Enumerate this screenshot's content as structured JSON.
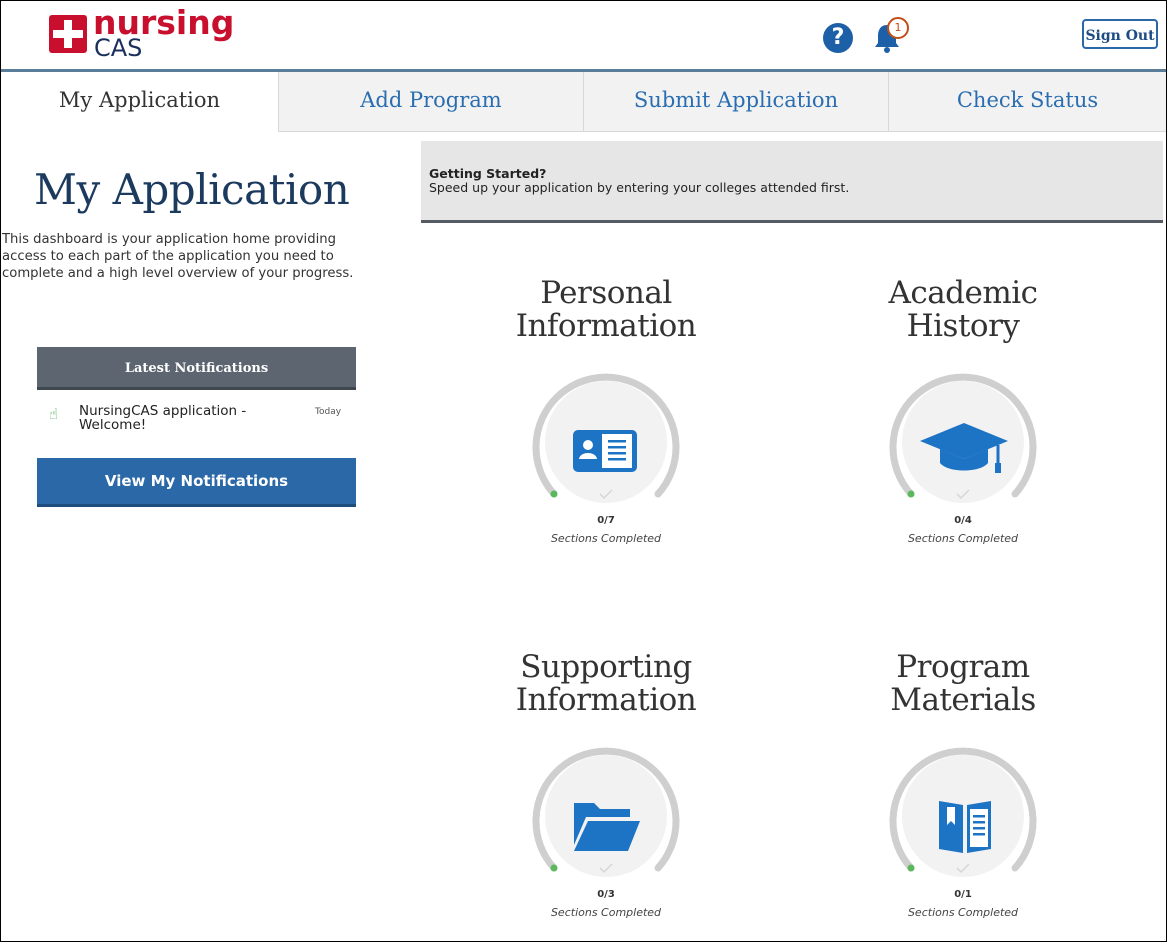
{
  "header": {
    "logo_line1": "nursing",
    "logo_line2": "CAS",
    "help_icon": "question-circle-icon",
    "bell_icon": "bell-icon",
    "notification_count": "1",
    "sign_out": "Sign Out"
  },
  "tabs": [
    {
      "label": "My Application",
      "active": true
    },
    {
      "label": "Add Program",
      "active": false
    },
    {
      "label": "Submit Application",
      "active": false
    },
    {
      "label": "Check Status",
      "active": false
    }
  ],
  "sidebar": {
    "title": "My Application",
    "description": "This dashboard is your application home providing access to each part of the application you need to complete and a high level overview of your progress.",
    "notifications": {
      "heading": "Latest Notifications",
      "items": [
        {
          "text": "NursingCAS application - Welcome!",
          "date": "Today",
          "icon": "hand-point-icon"
        }
      ],
      "button": "View My Notifications"
    }
  },
  "banner": {
    "title": "Getting Started?",
    "text": "Speed up your application by entering your colleges attended first."
  },
  "sections": [
    {
      "title_line1": "Personal",
      "title_line2": "Information",
      "progress": "0/7",
      "completed_label": "Sections Completed",
      "icon": "id-card-icon"
    },
    {
      "title_line1": "Academic",
      "title_line2": "History",
      "progress": "0/4",
      "completed_label": "Sections Completed",
      "icon": "graduation-cap-icon"
    },
    {
      "title_line1": "Supporting",
      "title_line2": "Information",
      "progress": "0/3",
      "completed_label": "Sections Completed",
      "icon": "folder-open-icon"
    },
    {
      "title_line1": "Program",
      "title_line2": "Materials",
      "progress": "0/1",
      "completed_label": "Sections Completed",
      "icon": "book-icon"
    }
  ],
  "colors": {
    "brand_red": "#c8102e",
    "brand_blue": "#2b68a8",
    "icon_blue": "#1d73c4",
    "progress_green": "#5cb85c"
  }
}
